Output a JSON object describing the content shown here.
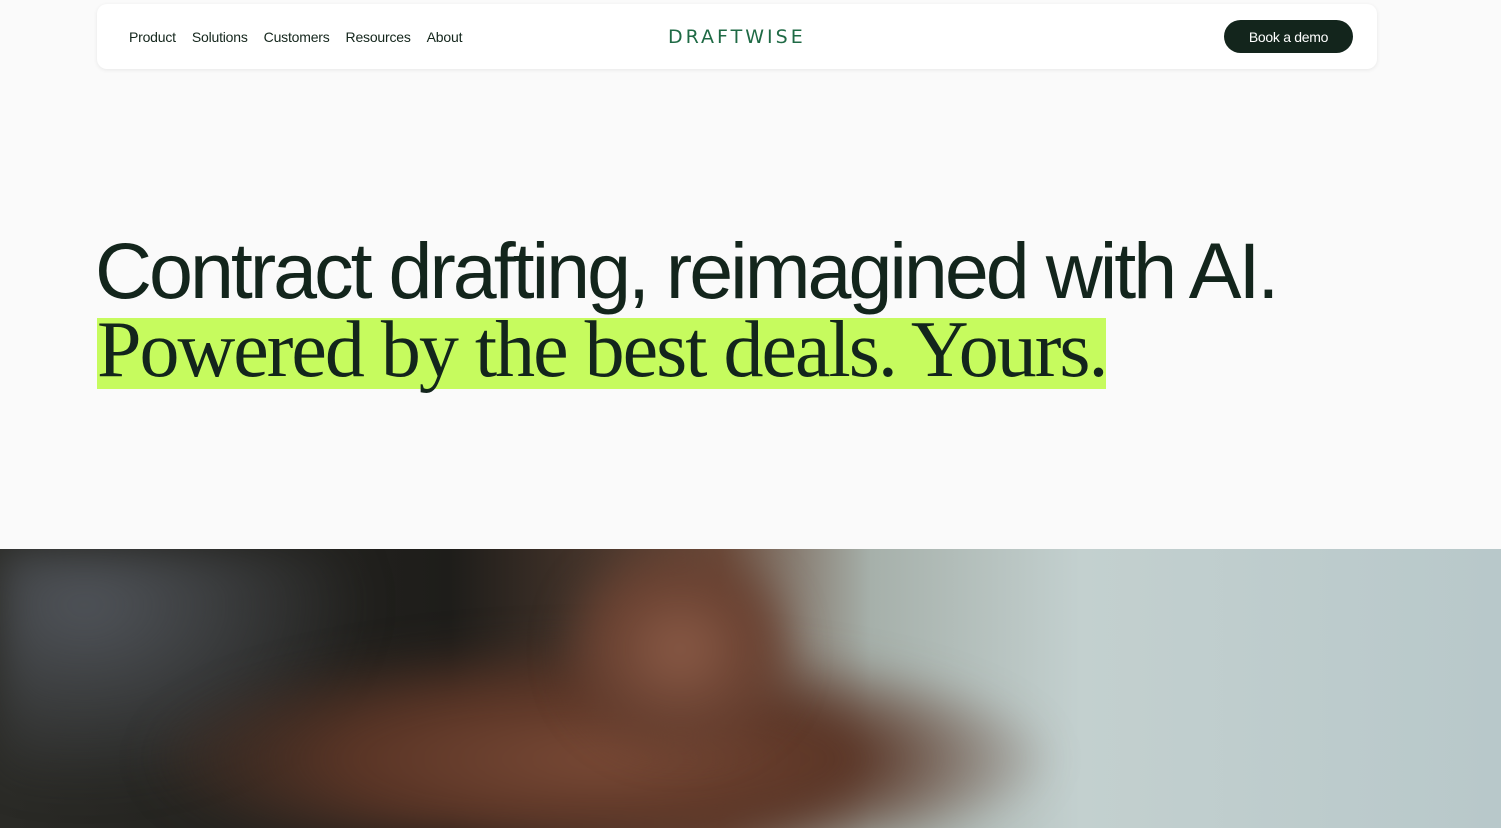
{
  "nav": {
    "links": [
      "Product",
      "Solutions",
      "Customers",
      "Resources",
      "About"
    ],
    "logo": "DRAFTWISE",
    "cta": "Book a demo"
  },
  "hero": {
    "line1": "Contract drafting, reimagined with AI.",
    "line2": "Powered by the best deals. Yours.",
    "highlight_color": "#c6fb5e",
    "text_color": "#13251c"
  },
  "colors": {
    "brand_green": "#1f6a45",
    "cta_bg": "#13251c",
    "page_bg": "#fafafa"
  }
}
